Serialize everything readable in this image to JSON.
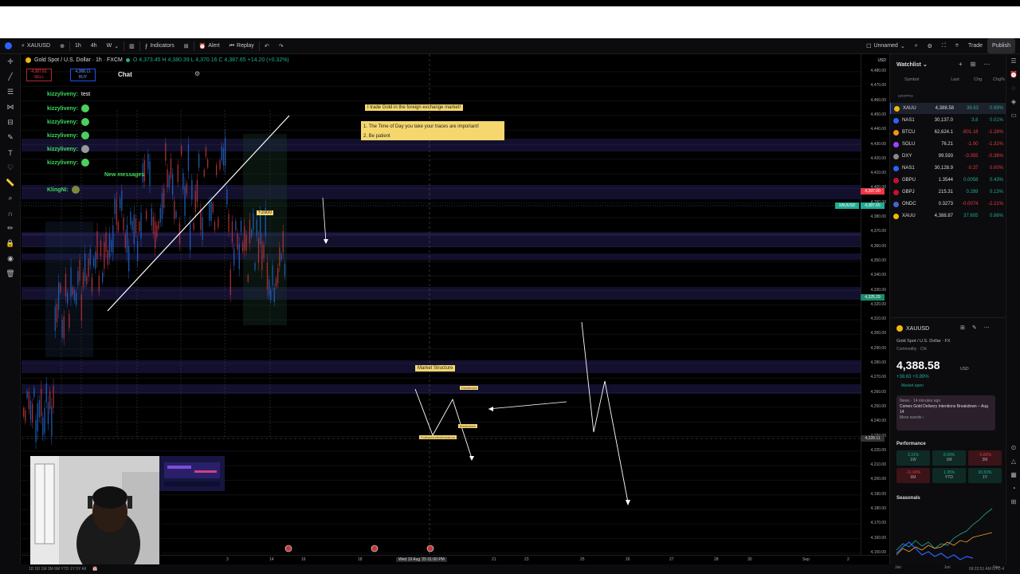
{
  "toolbar": {
    "symbol": "XAUUSD",
    "interval": "1h",
    "interval_alt": "4h",
    "interval_w": "W",
    "indicators_label": "Indicators",
    "alert_label": "Alert",
    "replay_label": "Replay",
    "layout_name": "Unnamed",
    "trade_label": "Trade",
    "publish_label": "Publish"
  },
  "chart_header": {
    "title": "Gold Spot / U.S. Dollar · 1h · FXCM",
    "ohlc": "O 4,373.45 H 4,380.39 L 4,370.16 C 4,387.65 +14.20 (+0.32%)",
    "sell_price": "4,387.81",
    "sell_label": "SELL",
    "buy_price": "4,388.11",
    "buy_label": "BUY"
  },
  "chat": {
    "title": "Chat",
    "messages": [
      {
        "user": "kizzyliveny:",
        "text": "test"
      },
      {
        "user": "kizzyliveny:",
        "text": ""
      },
      {
        "user": "kizzyliveny:",
        "text": ""
      },
      {
        "user": "kizzyliveny:",
        "text": ""
      },
      {
        "user": "kizzyliveny:",
        "text": ""
      },
      {
        "user": "kizzyliveny:",
        "text": ""
      }
    ],
    "new_messages": "New messages",
    "last_user": "KlingNi:"
  },
  "notes": {
    "title": "I trade Gold in the foreign exchange market!",
    "point1": "1. The Time of Day you take your traces are important!",
    "point2": "2. Be patient",
    "market_structure": "Market Structure",
    "downtrend": "Downtrend",
    "breakdown": "Breakdown",
    "retest": "Pullback/retest/breakout",
    "tag_2000": "+2000"
  },
  "price_axis": {
    "currency": "USD",
    "labels": [
      "4,480.00",
      "4,470.00",
      "4,460.00",
      "4,450.00",
      "4,440.00",
      "4,430.00",
      "4,420.00",
      "4,410.00",
      "4,400.00",
      "4,390.00",
      "4,380.00",
      "4,370.00",
      "4,360.00",
      "4,350.00",
      "4,340.00",
      "4,330.00",
      "4,320.00",
      "4,310.00",
      "4,300.00",
      "4,290.00",
      "4,280.00",
      "4,270.00",
      "4,260.00",
      "4,250.00",
      "4,240.00",
      "4,230.00",
      "4,220.00",
      "4,210.00",
      "4,200.00",
      "4,190.00",
      "4,180.00",
      "4,170.00",
      "4,160.00",
      "4,150.00"
    ],
    "tag_red": "4,397.00",
    "tag_symbol": "XAUUSD",
    "tag_current": "4,387.65",
    "tag_green": "4,325.29",
    "tag_grey": "4,228.11"
  },
  "time_axis": {
    "labels": [
      "3",
      "14",
      "16",
      "18",
      "21",
      "23",
      "25",
      "26",
      "27",
      "28",
      "30",
      "Sep",
      "2"
    ],
    "crosshair_label": "Wed 19 Aug '25   01:00 PM"
  },
  "bottom_bar": {
    "ranges": "1D  5D  1M  3M  6M  YTD  1Y  5Y  All",
    "clock": "09:23:51 AM UTC-4"
  },
  "watchlist": {
    "title": "Watchlist",
    "col_symbol": "Symbol",
    "col_last": "Last",
    "col_chg": "Chg",
    "col_pct": "Chg%",
    "group": "CRYPTO",
    "rows": [
      {
        "sym": "XAUU",
        "last": "4,388.58",
        "chg": "38.63",
        "pct": "0.89%",
        "dir": "pos",
        "color": "#f0b90b"
      },
      {
        "sym": "NAS1",
        "last": "30,137.0",
        "chg": "3.8",
        "pct": "0.01%",
        "dir": "pos",
        "color": "#2962ff"
      },
      {
        "sym": "BTCU",
        "last": "62,624.1",
        "chg": "-801.18",
        "pct": "-1.28%",
        "dir": "neg",
        "color": "#f7931a"
      },
      {
        "sym": "SOLU",
        "last": "76.21",
        "chg": "-1.00",
        "pct": "-1.31%",
        "dir": "neg",
        "color": "#9945ff"
      },
      {
        "sym": "DXY",
        "last": "99.593",
        "chg": "-0.355",
        "pct": "-0.36%",
        "dir": "neg",
        "color": "#888888"
      },
      {
        "sym": "NAS1",
        "last": "30,128.9",
        "chg": "-0.37",
        "pct": "0.00%",
        "dir": "neg",
        "color": "#2962ff"
      },
      {
        "sym": "GBPU",
        "last": "1.3544",
        "chg": "0.0058",
        "pct": "0.43%",
        "dir": "pos",
        "color": "#c8102e"
      },
      {
        "sym": "GBPJ",
        "last": "215.31",
        "chg": "0.289",
        "pct": "0.13%",
        "dir": "pos",
        "color": "#c8102e"
      },
      {
        "sym": "ONDC",
        "last": "0.3273",
        "chg": "-0.0074",
        "pct": "-2.21%",
        "dir": "neg",
        "color": "#4466cc"
      },
      {
        "sym": "XAUU",
        "last": "4,388.87",
        "chg": "37.605",
        "pct": "0.86%",
        "dir": "pos",
        "color": "#f0b90b"
      }
    ]
  },
  "details": {
    "symbol": "XAUUSD",
    "name": "Gold Spot / U.S. Dollar · FX",
    "category": "Commodity · Cfd",
    "price": "4,388.58",
    "unit": "USD",
    "change": "+38.63 +0.89%",
    "status": "Market open",
    "news_time": "News · 14 minutes ago",
    "news_headline": "Comex Gold Delivery Intentions Breakdown – Aug 14",
    "news_more": "More events ›"
  },
  "performance": {
    "title": "Performance",
    "cells": [
      {
        "value": "3.31%",
        "period": "1W",
        "dir": "p"
      },
      {
        "value": "8.09%",
        "period": "1M",
        "dir": "p"
      },
      {
        "value": "-5.82%",
        "period": "3M",
        "dir": "n"
      },
      {
        "value": "-11.00%",
        "period": "6M",
        "dir": "n"
      },
      {
        "value": "1.35%",
        "period": "YTD",
        "dir": "p"
      },
      {
        "value": "30.53%",
        "period": "1Y",
        "dir": "p"
      }
    ]
  },
  "seasonals": {
    "title": "Seasonals",
    "months": [
      "Jan",
      "Jun",
      "Nov"
    ]
  },
  "colors": {
    "zone": "#2a2466",
    "candle_up": "#1f5fbf",
    "candle_down": "#b2323a",
    "accent": "#2962ff",
    "note": "#f5d76e"
  }
}
